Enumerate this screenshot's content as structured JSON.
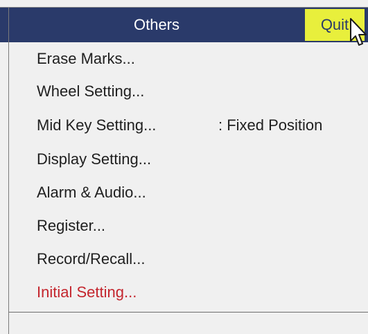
{
  "window": {
    "title": "Others",
    "quit_label": "Quit"
  },
  "menu": {
    "items": [
      {
        "label": "Erase Marks...",
        "value": ""
      },
      {
        "label": "Wheel Setting...",
        "value": ""
      },
      {
        "label": "Mid Key Setting...",
        "value": ": Fixed Position"
      },
      {
        "label": "Display Setting...",
        "value": ""
      },
      {
        "label": "Alarm & Audio...",
        "value": ""
      },
      {
        "label": "Register...",
        "value": ""
      },
      {
        "label": "Record/Recall...",
        "value": ""
      },
      {
        "label": "Initial Setting...",
        "value": ""
      }
    ]
  },
  "colors": {
    "title_bar": "#2a3a6a",
    "quit_button": "#e8ef3c",
    "highlight_item": "#c4262e"
  },
  "icons": {
    "cursor": "mouse-pointer-icon"
  }
}
